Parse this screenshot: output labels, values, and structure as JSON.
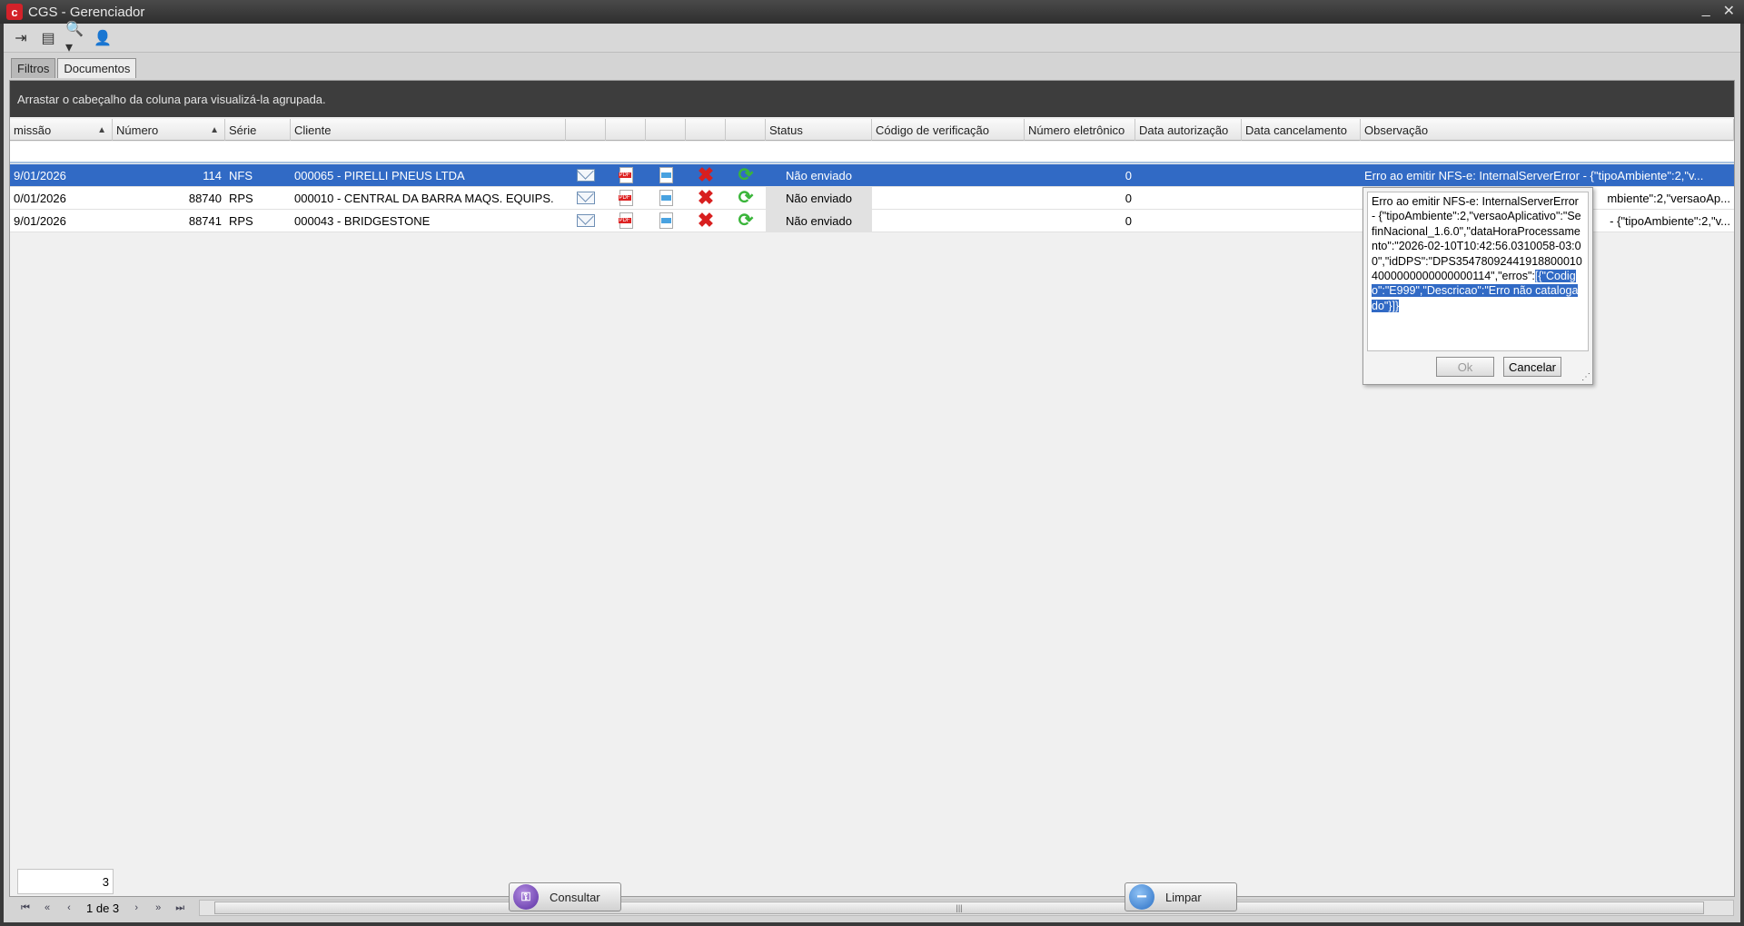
{
  "window": {
    "title": "CGS - Gerenciador"
  },
  "tabs": [
    {
      "label": "Filtros"
    },
    {
      "label": "Documentos"
    }
  ],
  "group_bar": "Arrastar o cabeçalho da coluna para visualizá-la agrupada.",
  "columns": [
    "missão",
    "Número",
    "Série",
    "Cliente",
    "Status",
    "Código de verificação",
    "Número eletrônico",
    "Data autorização",
    "Data cancelamento",
    "Observação"
  ],
  "rows": [
    {
      "date": "9/01/2026",
      "number": "114",
      "serie": "NFS",
      "client": "000065 - PIRELLI PNEUS LTDA",
      "status": "Não enviado",
      "num_eletronico": "0",
      "obs": "Erro ao emitir NFS-e: InternalServerError - {\"tipoAmbiente\":2,\"v..."
    },
    {
      "date": "0/01/2026",
      "number": "88740",
      "serie": "RPS",
      "client": "000010 - CENTRAL DA BARRA MAQS. EQUIPS.",
      "status": "Não enviado",
      "num_eletronico": "0",
      "obs": "mbiente\":2,\"versaoAp..."
    },
    {
      "date": "9/01/2026",
      "number": "88741",
      "serie": "RPS",
      "client": "000043 - BRIDGESTONE",
      "status": "Não enviado",
      "num_eletronico": "0",
      "obs": "- {\"tipoAmbiente\":2,\"v..."
    }
  ],
  "popup": {
    "text": "Erro ao emitir NFS-e: InternalServerError - {\"tipoAmbiente\":2,\"versaoAplicativo\":\"SefinNacional_1.6.0\",\"dataHoraProcessamento\":\"2026-02-10T10:42:56.0310058-03:00\",\"idDPS\":\"DPS354780924419188000104000000000000000114\",\"erros\":",
    "selected_text": "[{\"Codigo\":\"E999\",\"Descricao\":\"Erro não catalogado\"}]}",
    "ok_label": "Ok",
    "cancel_label": "Cancelar"
  },
  "footer": {
    "count": "3",
    "page_info": "1 de 3"
  },
  "buttons": {
    "consultar": "Consultar",
    "limpar": "Limpar"
  },
  "colors": {
    "selection": "#316ac5",
    "group_bar": "#3d3d3d"
  }
}
